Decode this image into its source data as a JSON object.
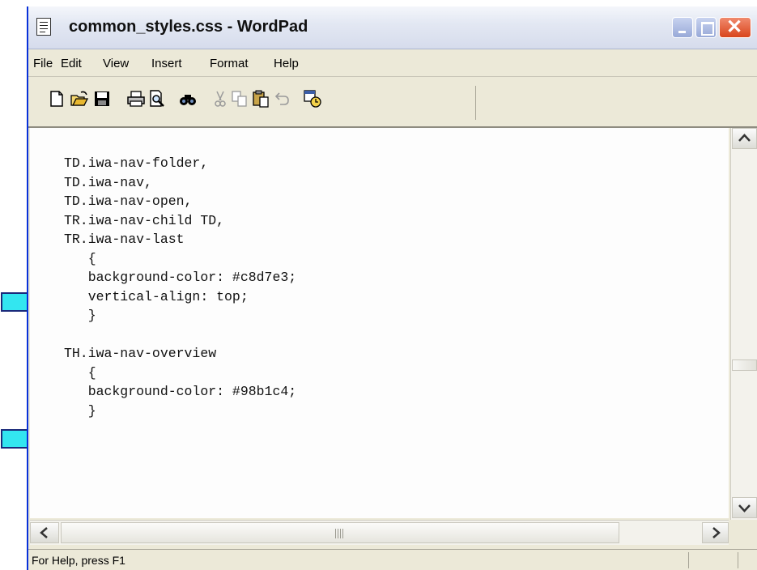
{
  "window": {
    "title": "common_styles.css - WordPad",
    "close_glyph": "✕"
  },
  "menu": {
    "items": [
      "File",
      "Edit",
      "View",
      "Insert",
      "Format",
      "Help"
    ]
  },
  "toolbar": {
    "buttons": [
      "new-icon",
      "open-icon",
      "save-icon",
      "print-icon",
      "print-preview-icon",
      "find-icon",
      "cut-icon",
      "copy-icon",
      "paste-icon",
      "undo-icon",
      "insert-datetime-icon"
    ]
  },
  "document": {
    "lines": [
      "TD.iwa-nav-folder,",
      "TD.iwa-nav,",
      "TD.iwa-nav-open,",
      "TR.iwa-nav-child TD,",
      "TR.iwa-nav-last",
      "   {",
      "   background-color: #c8d7e3;",
      "   vertical-align: top;",
      "   }",
      "",
      "TH.iwa-nav-overview",
      "   {",
      "   background-color: #98b1c4;",
      "   }"
    ]
  },
  "statusbar": {
    "text": "For Help, press F1"
  },
  "annotations": {
    "arrow_color": "#33e6f0"
  }
}
